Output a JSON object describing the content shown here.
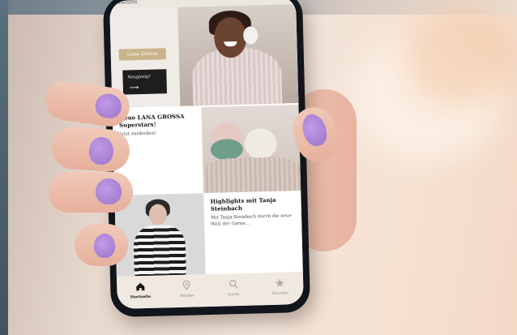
{
  "status_bar": {
    "text": "Startseite"
  },
  "hero": {
    "brand_tag": "Lana Grossa",
    "cta_label": "Neugierig?",
    "cta_arrow": "⟶"
  },
  "tiles": [
    {
      "title": "Neue LANA GROSSA Superstars!",
      "subtitle": "Jetzt entdecken!"
    },
    {
      "title": "Highlights mit Tanja Steinbach",
      "subtitle": "Mit Tanja Steinbach durch die neue Welt der Garne…"
    }
  ],
  "navbar": {
    "items": [
      {
        "label": "Startseite",
        "icon": "home-icon",
        "active": true
      },
      {
        "label": "Händler",
        "icon": "map-pin-icon",
        "active": false
      },
      {
        "label": "Suche",
        "icon": "search-icon",
        "active": false
      },
      {
        "label": "Favoriten",
        "icon": "star-icon",
        "active": false
      }
    ]
  },
  "colors": {
    "accent_gold": "#c9b489",
    "nav_bg": "#efe9e1",
    "nail": "#a882d6",
    "phone_frame": "#12151c"
  }
}
